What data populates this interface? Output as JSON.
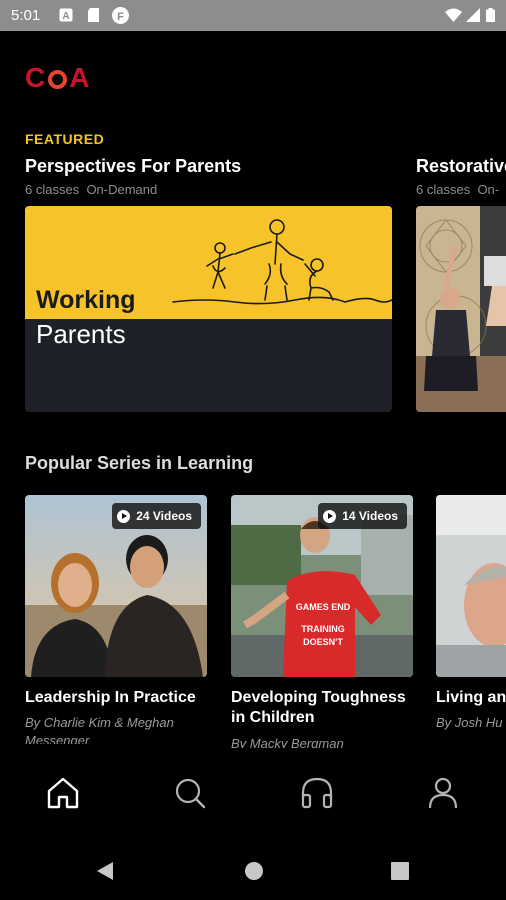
{
  "status_bar": {
    "time": "5:01"
  },
  "app": {
    "logo_letters": [
      "C",
      "O",
      "A"
    ],
    "brand_red": "#c8142a",
    "accent_yellow": "#f4c329"
  },
  "featured": {
    "label": "FEATURED",
    "cards": [
      {
        "title": "Perspectives For Parents",
        "classes": "6 classes",
        "type": "On-Demand",
        "art_line1": "Working",
        "art_line2": "Parents"
      },
      {
        "title": "Restorative",
        "classes": "6 classes",
        "type": "On-"
      }
    ]
  },
  "popular": {
    "title": "Popular Series in Learning",
    "items": [
      {
        "videos": "24 Videos",
        "title": "Leadership In Practice",
        "author": "By Charlie Kim & Meghan Messenger"
      },
      {
        "videos": "14 Videos",
        "title_line1": "Developing Toughness",
        "title_line2": "in Children",
        "author": "By Macky Bergman"
      },
      {
        "title": "Living an",
        "author": "By Josh Hu"
      }
    ]
  },
  "bottom_nav": {
    "items": [
      {
        "icon": "home-icon",
        "active": true
      },
      {
        "icon": "search-icon"
      },
      {
        "icon": "headphones-icon"
      },
      {
        "icon": "profile-icon"
      }
    ]
  },
  "system_nav": [
    "back-icon",
    "home-circle-icon",
    "recents-icon"
  ]
}
